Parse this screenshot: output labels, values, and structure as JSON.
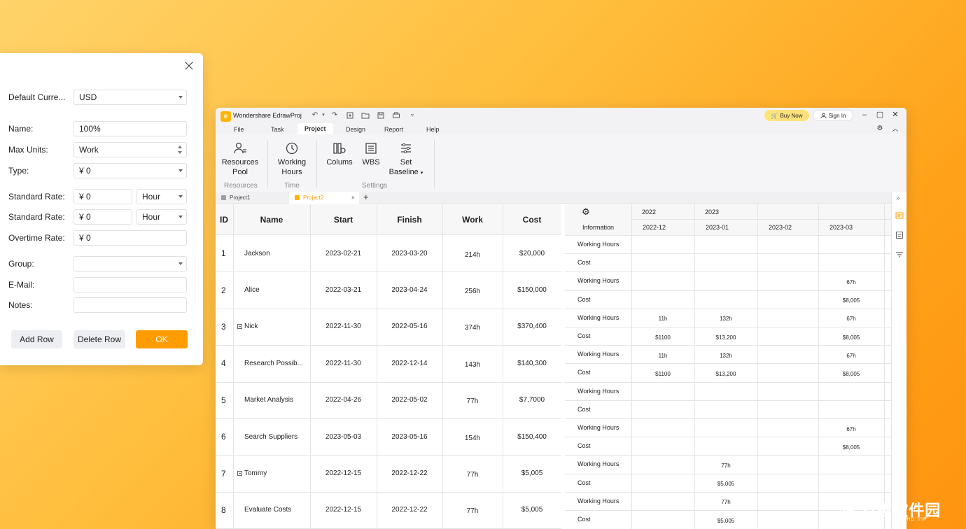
{
  "dialog": {
    "fields": [
      {
        "label": "Default Curre...",
        "value": "USD"
      },
      {
        "label": "Name:",
        "value": "100%"
      },
      {
        "label": "Max Units:",
        "value": "Work"
      },
      {
        "label": "Type:",
        "value": "¥ 0"
      },
      {
        "label": "Standard Rate:",
        "value": "¥ 0",
        "unit": "Hour"
      },
      {
        "label": "Standard Rate:",
        "value": "¥ 0",
        "unit": "Hour"
      },
      {
        "label": "Overtime Rate:",
        "value": "¥ 0"
      },
      {
        "label": "Group:",
        "value": ""
      },
      {
        "label": "E-Mail:",
        "value": ""
      },
      {
        "label": "Notes:",
        "value": ""
      }
    ],
    "add_row": "Add Row",
    "delete_row": "Delete Row",
    "ok": "OK"
  },
  "app": {
    "title": "Wondershare EdrawProj",
    "buy_now": "Buy Now",
    "sign_in": "Sign In",
    "menus": [
      "File",
      "Task",
      "Project",
      "Design",
      "Report",
      "Help"
    ],
    "active_menu": "Project",
    "ribbon": {
      "resources_pool": [
        "Resources",
        "Pool"
      ],
      "working_hours": [
        "Working",
        "Hours"
      ],
      "colums": "Colums",
      "wbs": "WBS",
      "set_baseline": [
        "Set",
        "Baseline"
      ],
      "groups": [
        "Resources",
        "Time",
        "Settings"
      ]
    },
    "doc_tabs": [
      "Project1",
      "Project2"
    ],
    "active_tab": "Project2"
  },
  "table": {
    "headers": [
      "ID",
      "Name",
      "Start",
      "Finish",
      "Work",
      "Cost"
    ],
    "rows": [
      {
        "id": "1",
        "name": "Jackson",
        "start": "2023-02-21",
        "finish": "2023-03-20",
        "work": "214h",
        "cost": "$20,000",
        "group": false
      },
      {
        "id": "2",
        "name": "Alice",
        "start": "2022-03-21",
        "finish": "2023-04-24",
        "work": "256h",
        "cost": "$150,000",
        "group": false
      },
      {
        "id": "3",
        "name": "Nick",
        "start": "2022-11-30",
        "finish": "2022-05-16",
        "work": "374h",
        "cost": "$370,400",
        "group": true
      },
      {
        "id": "4",
        "name": "Research Possib...",
        "start": "2022-11-30",
        "finish": "2022-12-14",
        "work": "143h",
        "cost": "$140,300",
        "group": false
      },
      {
        "id": "5",
        "name": "Market Analysis",
        "start": "2022-04-26",
        "finish": "2022-05-02",
        "work": "77h",
        "cost": "$7,7000",
        "group": false
      },
      {
        "id": "6",
        "name": "Search Suppliers",
        "start": "2023-05-03",
        "finish": "2023-05-16",
        "work": "154h",
        "cost": "$150,400",
        "group": false
      },
      {
        "id": "7",
        "name": "Tommy",
        "start": "2022-12-15",
        "finish": "2022-12-22",
        "work": "77h",
        "cost": "$5,005",
        "group": true
      },
      {
        "id": "8",
        "name": "Evaluate Costs",
        "start": "2022-12-15",
        "finish": "2022-12-22",
        "work": "77h",
        "cost": "$5,005",
        "group": false
      }
    ]
  },
  "usage": {
    "info_label": "Information",
    "years": [
      "2022",
      "2023"
    ],
    "months": [
      "2022-12",
      "2023-01",
      "2023-02",
      "2023-03"
    ],
    "rows": [
      {
        "label": "Working Hours",
        "vals": [
          "",
          "",
          "",
          ""
        ]
      },
      {
        "label": "Cost",
        "vals": [
          "",
          "",
          "",
          ""
        ]
      },
      {
        "label": "Working Hours",
        "vals": [
          "",
          "",
          "",
          "67h"
        ]
      },
      {
        "label": "Cost",
        "vals": [
          "",
          "",
          "",
          "$8,005"
        ]
      },
      {
        "label": "Working Hours",
        "vals": [
          "11h",
          "132h",
          "",
          "67h"
        ]
      },
      {
        "label": "Cost",
        "vals": [
          "$1100",
          "$13,200",
          "",
          "$8,005"
        ]
      },
      {
        "label": "Working Hours",
        "vals": [
          "11h",
          "132h",
          "",
          "67h"
        ]
      },
      {
        "label": "Cost",
        "vals": [
          "$1100",
          "$13,200",
          "",
          "$8,005"
        ]
      },
      {
        "label": "Working Hours",
        "vals": [
          "",
          "",
          "",
          ""
        ]
      },
      {
        "label": "Cost",
        "vals": [
          "",
          "",
          "",
          ""
        ]
      },
      {
        "label": "Working Hours",
        "vals": [
          "",
          "",
          "",
          "67h"
        ]
      },
      {
        "label": "Cost",
        "vals": [
          "",
          "",
          "",
          "$8,005"
        ]
      },
      {
        "label": "Working Hours",
        "vals": [
          "",
          "77h",
          "",
          ""
        ]
      },
      {
        "label": "Cost",
        "vals": [
          "",
          "$5,005",
          "",
          ""
        ]
      },
      {
        "label": "Working Hours",
        "vals": [
          "",
          "77h",
          "",
          ""
        ]
      },
      {
        "label": "Cost",
        "vals": [
          "",
          "$5,005",
          "",
          ""
        ]
      }
    ]
  },
  "watermark": {
    "main": "万象软件园",
    "sub": "WXHD VIP"
  }
}
